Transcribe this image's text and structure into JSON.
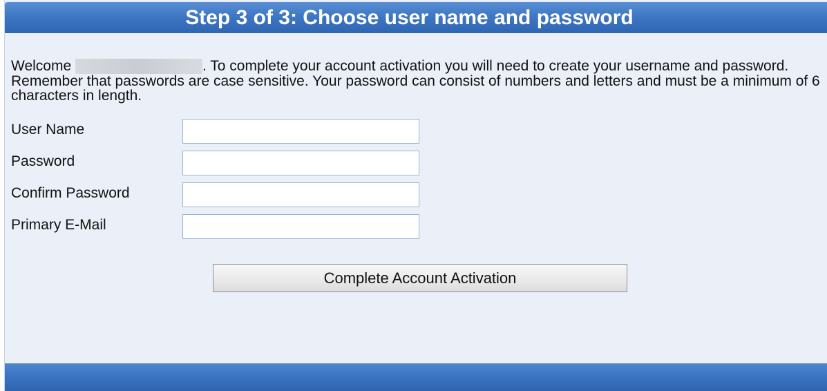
{
  "header": {
    "title": "Step 3 of 3: Choose user name and password"
  },
  "intro": {
    "welcome_prefix": "Welcome",
    "body": ". To complete your account activation you will need to create your username and password. Remember that passwords are case sensitive. Your password can consist of numbers and letters and must be a minimum of 6 characters in length."
  },
  "form": {
    "fields": [
      {
        "label": "User Name",
        "value": "",
        "placeholder": ""
      },
      {
        "label": "Password",
        "value": "",
        "placeholder": ""
      },
      {
        "label": "Confirm Password",
        "value": "",
        "placeholder": ""
      },
      {
        "label": "Primary E-Mail",
        "value": "",
        "placeholder": ""
      }
    ],
    "submit_label": "Complete Account Activation"
  },
  "colors": {
    "header_blue": "#3e77c4",
    "panel_background": "#ebf0f8",
    "input_border": "#98b4d8"
  }
}
